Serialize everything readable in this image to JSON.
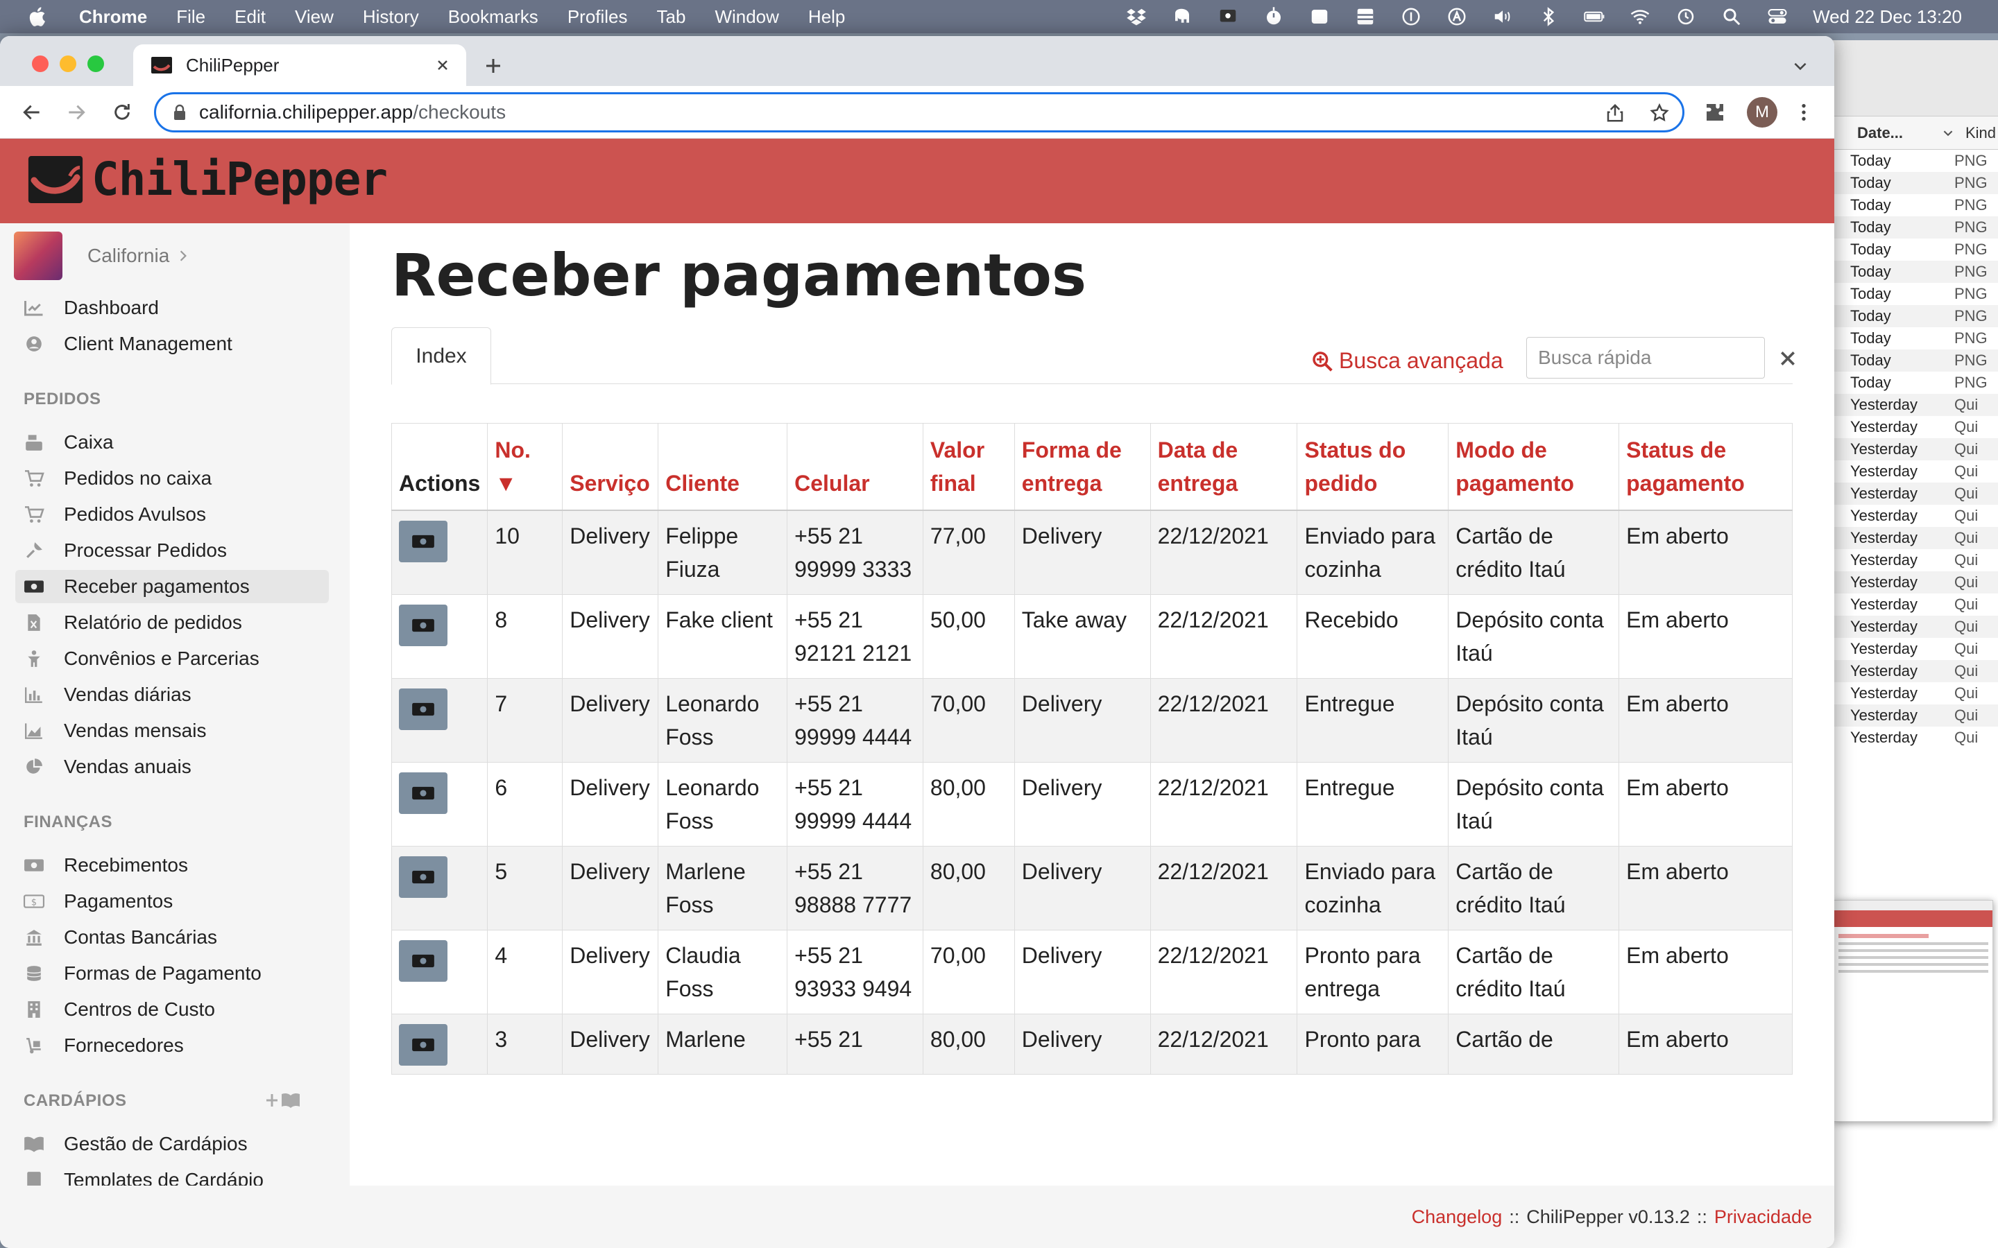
{
  "menubar": {
    "app": "Chrome",
    "items": [
      "File",
      "Edit",
      "View",
      "History",
      "Bookmarks",
      "Profiles",
      "Tab",
      "Window",
      "Help"
    ],
    "clock": "Wed 22 Dec  13:20"
  },
  "browser": {
    "tab_title": "ChiliPepper",
    "url_host": "california.chilipepper.app",
    "url_path": "/checkouts",
    "avatar": "M"
  },
  "finder": {
    "col_date": "Date...",
    "col_kind": "Kind",
    "rows": [
      [
        "Today",
        "PNG"
      ],
      [
        "Today",
        "PNG"
      ],
      [
        "Today",
        "PNG"
      ],
      [
        "Today",
        "PNG"
      ],
      [
        "Today",
        "PNG"
      ],
      [
        "Today",
        "PNG"
      ],
      [
        "Today",
        "PNG"
      ],
      [
        "Today",
        "PNG"
      ],
      [
        "Today",
        "PNG"
      ],
      [
        "Today",
        "PNG"
      ],
      [
        "Today",
        "PNG"
      ],
      [
        "Yesterday",
        "Qui"
      ],
      [
        "Yesterday",
        "Qui"
      ],
      [
        "Yesterday",
        "Qui"
      ],
      [
        "Yesterday",
        "Qui"
      ],
      [
        "Yesterday",
        "Qui"
      ],
      [
        "Yesterday",
        "Qui"
      ],
      [
        "Yesterday",
        "Qui"
      ],
      [
        "Yesterday",
        "Qui"
      ],
      [
        "Yesterday",
        "Qui"
      ],
      [
        "Yesterday",
        "Qui"
      ],
      [
        "Yesterday",
        "Qui"
      ],
      [
        "Yesterday",
        "Qui"
      ],
      [
        "Yesterday",
        "Qui"
      ],
      [
        "Yesterday",
        "Qui"
      ],
      [
        "Yesterday",
        "Qui"
      ],
      [
        "Yesterday",
        "Qui"
      ]
    ]
  },
  "app": {
    "logo": "ChiliPepper",
    "tenant": "California"
  },
  "sidebar": {
    "top": [
      {
        "label": "Dashboard",
        "icon": "chart-line-icon"
      },
      {
        "label": "Client Management",
        "icon": "user-circle-icon"
      }
    ],
    "pedidos_header": "PEDIDOS",
    "pedidos": [
      {
        "label": "Caixa",
        "icon": "cash-register-icon"
      },
      {
        "label": "Pedidos no caixa",
        "icon": "cart-icon"
      },
      {
        "label": "Pedidos Avulsos",
        "icon": "cart-icon"
      },
      {
        "label": "Processar Pedidos",
        "icon": "wrench-icon"
      },
      {
        "label": "Receber pagamentos",
        "icon": "money-bill-icon",
        "active": true
      },
      {
        "label": "Relatório de pedidos",
        "icon": "file-excel-icon"
      },
      {
        "label": "Convênios e Parcerias",
        "icon": "handshake-icon"
      },
      {
        "label": "Vendas diárias",
        "icon": "bar-chart-icon"
      },
      {
        "label": "Vendas mensais",
        "icon": "area-chart-icon"
      },
      {
        "label": "Vendas anuais",
        "icon": "pie-chart-icon"
      }
    ],
    "financas_header": "FINANÇAS",
    "financas": [
      {
        "label": "Recebimentos",
        "icon": "money-bill-icon"
      },
      {
        "label": "Pagamentos",
        "icon": "dollar-bill-icon"
      },
      {
        "label": "Contas Bancárias",
        "icon": "bank-icon"
      },
      {
        "label": "Formas de Pagamento",
        "icon": "coins-icon"
      },
      {
        "label": "Centros de Custo",
        "icon": "building-icon"
      },
      {
        "label": "Fornecedores",
        "icon": "dolly-icon"
      }
    ],
    "cardapios_header": "CARDÁPIOS",
    "cardapios": [
      {
        "label": "Gestão de Cardápios",
        "icon": "book-open-icon"
      },
      {
        "label": "Templates de Cardápio",
        "icon": "book-icon"
      }
    ]
  },
  "main": {
    "title": "Receber pagamentos",
    "tab_index": "Index",
    "adv_search": "Busca avançada",
    "quick_placeholder": "Busca rápida"
  },
  "table": {
    "headers": [
      [
        "Actions"
      ],
      [
        "No. ▼"
      ],
      [
        "Serviço"
      ],
      [
        "Cliente"
      ],
      [
        "Celular"
      ],
      [
        "Valor",
        "final"
      ],
      [
        "Forma de",
        "entrega"
      ],
      [
        "Data de",
        "entrega"
      ],
      [
        "Status do",
        "pedido"
      ],
      [
        "Modo de",
        "pagamento"
      ],
      [
        "Status de",
        "pagamento"
      ]
    ],
    "rows": [
      [
        "10",
        "Delivery",
        "Felippe Fiuza",
        "+55 21 99999 3333",
        "77,00",
        "Delivery",
        "22/12/2021",
        "Enviado para cozinha",
        "Cartão de crédito Itaú",
        "Em aberto"
      ],
      [
        "8",
        "Delivery",
        "Fake client",
        "+55 21 92121 2121",
        "50,00",
        "Take away",
        "22/12/2021",
        "Recebido",
        "Depósito conta Itaú",
        "Em aberto"
      ],
      [
        "7",
        "Delivery",
        "Leonardo Foss",
        "+55 21 99999 4444",
        "70,00",
        "Delivery",
        "22/12/2021",
        "Entregue",
        "Depósito conta Itaú",
        "Em aberto"
      ],
      [
        "6",
        "Delivery",
        "Leonardo Foss",
        "+55 21 99999 4444",
        "80,00",
        "Delivery",
        "22/12/2021",
        "Entregue",
        "Depósito conta Itaú",
        "Em aberto"
      ],
      [
        "5",
        "Delivery",
        "Marlene Foss",
        "+55 21 98888 7777",
        "80,00",
        "Delivery",
        "22/12/2021",
        "Enviado para cozinha",
        "Cartão de crédito Itaú",
        "Em aberto"
      ],
      [
        "4",
        "Delivery",
        "Claudia Foss",
        "+55 21 93933 9494",
        "70,00",
        "Delivery",
        "22/12/2021",
        "Pronto para entrega",
        "Cartão de crédito Itaú",
        "Em aberto"
      ],
      [
        "3",
        "Delivery",
        "Marlene",
        "+55 21",
        "80,00",
        "Delivery",
        "22/12/2021",
        "Pronto para",
        "Cartão de",
        "Em aberto"
      ]
    ]
  },
  "footer": {
    "changelog": "Changelog",
    "sep1": "::",
    "version": "ChiliPepper v0.13.2",
    "sep2": "::",
    "privacy": "Privacidade"
  },
  "colors": {
    "brand": "#cc5350",
    "link": "#c9302c"
  }
}
